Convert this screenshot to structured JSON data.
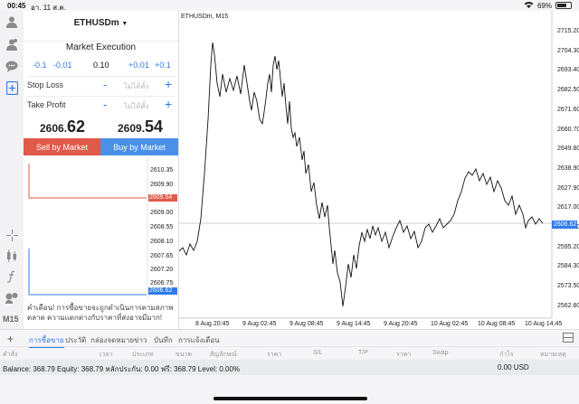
{
  "status": {
    "time": "00:45",
    "date": "อา. 11 ส.ค.",
    "battery": "69%",
    "battery_level": 0.69
  },
  "panel": {
    "symbol": "ETHUSDm",
    "execution": "Market Execution",
    "lot_buttons": [
      "-0.1",
      "-0.01",
      "0.10",
      "+0.01",
      "+0.1"
    ],
    "stop_loss": {
      "label": "Stop Loss",
      "minus": "-",
      "placeholder": "ไม่ได้ตั้ง",
      "plus": "+"
    },
    "take_profit": {
      "label": "Take Profit",
      "minus": "-",
      "placeholder": "ไม่ได้ตั้ง",
      "plus": "+"
    },
    "sell_price": {
      "small": "2606.",
      "big": "62"
    },
    "buy_price": {
      "small": "2609.",
      "big": "54"
    },
    "sell_button": "Sell by Market",
    "buy_button": "Buy by Market"
  },
  "tick_chart": {
    "axis": [
      "2610.35",
      "2609.90",
      "2609.45",
      "2609.00",
      "2608.55",
      "2608.10",
      "2607.65",
      "2607.20",
      "2606.75"
    ],
    "ask_tag": "2609.54",
    "bid_tag": "2606.62",
    "colors": {
      "ask": "#e05a4a",
      "bid": "#2f7be8"
    }
  },
  "warning": "คำเตือน! การซื้อขายจะถูกดำเนินการตามสภาพตลาด ความแตกต่างกับราคาที่ส่งอาจมีมาก!",
  "main_chart": {
    "title": "ETHUSDm, M15",
    "y_ticks": [
      "2715.20",
      "2704.30",
      "2693.40",
      "2682.50",
      "2671.60",
      "2660.70",
      "2649.80",
      "2638.90",
      "2627.90",
      "2617.00",
      "2606.10",
      "2595.20",
      "2584.30",
      "2573.50",
      "2562.60"
    ],
    "x_ticks": [
      "8 Aug 20:45",
      "9 Aug 02:45",
      "9 Aug 08:45",
      "9 Aug 14:45",
      "9 Aug 20:45",
      "10 Aug 02:45",
      "10 Aug 08:45",
      "10 Aug 14:45"
    ],
    "price_tag": "2606.62"
  },
  "rail": {
    "timeframe": "M15"
  },
  "tabs": [
    "การซื้อขาย",
    "ประวัติ",
    "กล่องจดหมาย",
    "ข่าว",
    "บันทึก",
    "การแจ้งเตือน"
  ],
  "columns": [
    "คำสั่ง",
    "เวลา",
    "ประเภท",
    "ขนาด",
    "สัญลักษณ์",
    "ราคา",
    "S/L",
    "T/P",
    "ราคา",
    "Swap",
    "กำไร",
    "หมายเหตุ"
  ],
  "balance": {
    "left": "Balance: 368.79  Equity: 368.79  หลักประกัน: 0.00  ฟรี: 368.79  Level: 0.00%",
    "profit": "0.00  USD"
  },
  "icons": [
    "user-icon",
    "chat-icon",
    "new-order-icon",
    "crosshair-icon",
    "indicators-icon",
    "function-icon",
    "objects-icon",
    "add-icon",
    "split-view-icon"
  ]
}
